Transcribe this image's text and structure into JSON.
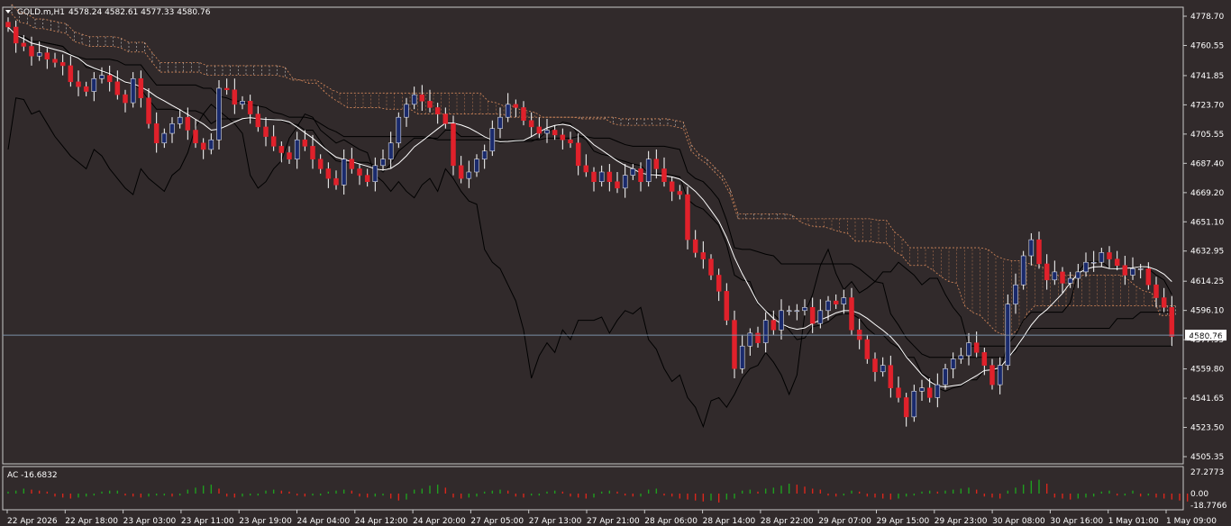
{
  "header": {
    "symbol_timeframe": "GOLD.m,H1",
    "ohlc": "4578.24 4582.61 4577.33 4580.76"
  },
  "indicator": {
    "label": "AC -16.6832",
    "scale": [
      "27.2773",
      "0.00",
      "-18.7766"
    ]
  },
  "current_price": "4580.76",
  "price_scale": [
    "4778.70",
    "4760.55",
    "4741.85",
    "4723.70",
    "4705.55",
    "4687.40",
    "4669.20",
    "4651.10",
    "4632.95",
    "4614.25",
    "4596.10",
    "4577.95",
    "4559.80",
    "4541.65",
    "4523.50",
    "4505.35"
  ],
  "time_scale": [
    "22 Apr 2026",
    "22 Apr 18:00",
    "23 Apr 03:00",
    "23 Apr 11:00",
    "23 Apr 19:00",
    "24 Apr 04:00",
    "24 Apr 12:00",
    "24 Apr 20:00",
    "27 Apr 05:00",
    "27 Apr 13:00",
    "27 Apr 21:00",
    "28 Apr 06:00",
    "28 Apr 14:00",
    "28 Apr 22:00",
    "29 Apr 07:00",
    "29 Apr 15:00",
    "29 Apr 23:00",
    "30 Apr 08:00",
    "30 Apr 16:00",
    "1 May 01:00",
    "1 May 09:00"
  ],
  "colors": {
    "background": "#312a2b",
    "bull_candle": "#1a2a6c",
    "bear_candle": "#e0212b",
    "axis": "#c9c9c9",
    "text": "#ffffff",
    "ma_line": "#ffffff",
    "ichimoku": "#000000",
    "cloud_up": "#ffffff",
    "cloud_down": "#d88a5c",
    "ac_up": "#1f9e1f",
    "ac_down": "#d9261c"
  },
  "chart_data": {
    "type": "candlestick",
    "symbol": "GOLD.m",
    "timeframe": "H1",
    "ylim": [
      4505.35,
      4778.7
    ],
    "current_price": 4580.76,
    "closes": [
      4772,
      4762,
      4760,
      4754,
      4756,
      4752,
      4750,
      4748,
      4738,
      4735,
      4732,
      4740,
      4742,
      4738,
      4730,
      4725,
      4740,
      4728,
      4712,
      4700,
      4706,
      4712,
      4716,
      4708,
      4700,
      4696,
      4702,
      4734,
      4733,
      4724,
      4726,
      4718,
      4710,
      4704,
      4698,
      4694,
      4690,
      4702,
      4698,
      4690,
      4684,
      4678,
      4674,
      4690,
      4684,
      4680,
      4676,
      4686,
      4690,
      4700,
      4716,
      4724,
      4730,
      4726,
      4722,
      4718,
      4712,
      4686,
      4678,
      4682,
      4690,
      4695,
      4709,
      4716,
      4724,
      4722,
      4714,
      4710,
      4706,
      4708,
      4705,
      4702,
      4700,
      4686,
      4682,
      4676,
      4682,
      4676,
      4672,
      4680,
      4684,
      4676,
      4690,
      4684,
      4676,
      4670,
      4668,
      4640,
      4632,
      4628,
      4618,
      4608,
      4590,
      4560,
      4574,
      4582,
      4576,
      4590,
      4584,
      4596,
      4596,
      4596,
      4598,
      4588,
      4596,
      4602,
      4600,
      4604,
      4584,
      4578,
      4566,
      4558,
      4562,
      4548,
      4542,
      4530,
      4546,
      4548,
      4542,
      4550,
      4560,
      4566,
      4568,
      4576,
      4570,
      4562,
      4550,
      4562,
      4600,
      4612,
      4630,
      4640,
      4625,
      4615,
      4620,
      4613,
      4616,
      4620,
      4626,
      4626,
      4632,
      4628,
      4624,
      4618,
      4622,
      4622,
      4612,
      4604,
      4598,
      4580
    ]
  },
  "ac_data": [
    2,
    3,
    5,
    4,
    3,
    2,
    -3,
    -4,
    -5,
    -4,
    -3,
    -2,
    2,
    3,
    3,
    -2,
    -3,
    -4,
    -3,
    -2,
    -2,
    -3,
    -2,
    4,
    6,
    8,
    9,
    5,
    -3,
    -4,
    -3,
    -2,
    -2,
    3,
    4,
    3,
    2,
    -2,
    -3,
    -2,
    -2,
    2,
    3,
    4,
    3,
    -3,
    -4,
    -3,
    -2,
    -5,
    -7,
    -6,
    4,
    5,
    8,
    9,
    6,
    -4,
    -5,
    -4,
    -3,
    2,
    3,
    4,
    3,
    -3,
    -4,
    -2,
    -2,
    2,
    3,
    2,
    -3,
    -4,
    -5,
    -4,
    2,
    3,
    2,
    -2,
    -3,
    -3,
    4,
    5,
    -2,
    -3,
    -5,
    -6,
    -7,
    -8,
    -7,
    -9,
    -6,
    -5,
    3,
    4,
    2,
    5,
    6,
    8,
    10,
    9,
    7,
    5,
    4,
    -2,
    -3,
    -2,
    3,
    2,
    -3,
    -4,
    -5,
    -6,
    -5,
    -3,
    -2,
    2,
    3,
    2,
    3,
    4,
    5,
    6,
    4,
    -3,
    -4,
    -5,
    3,
    6,
    9,
    13,
    14,
    10,
    -4,
    -5,
    -6,
    -5,
    -4,
    -3,
    2,
    3,
    -2,
    -2,
    3,
    -3,
    -2,
    -4,
    -5,
    -6,
    -7,
    -8
  ]
}
